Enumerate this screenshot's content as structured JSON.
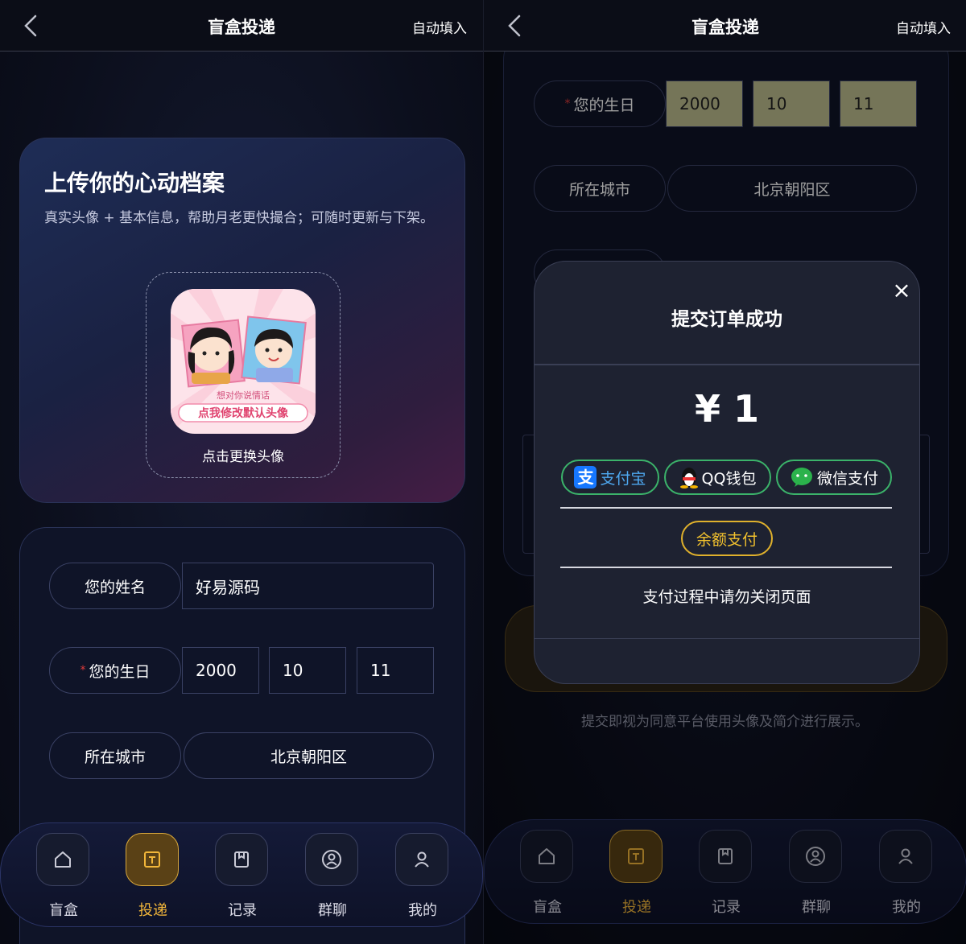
{
  "header": {
    "title": "盲盒投递",
    "autofill": "自动填入"
  },
  "upload_card": {
    "title": "上传你的心动档案",
    "subtitle": "真实头像 + 基本信息，帮助月老更快撮合；可随时更新与下架。",
    "avatar_line1": "想对你说情话",
    "avatar_line2": "点我修改默认头像",
    "change_avatar": "点击更换头像"
  },
  "form": {
    "name_label": "您的姓名",
    "name_value": "好易源码",
    "birthday_label": "您的生日",
    "birthday_required": "*",
    "birth_year": "2000",
    "birth_month": "10",
    "birth_day": "11",
    "city_label": "所在城市",
    "city_value": "北京朝阳区"
  },
  "nav": [
    {
      "label": "盲盒",
      "icon": "home-icon",
      "active": false
    },
    {
      "label": "投递",
      "icon": "deliver-icon",
      "active": true
    },
    {
      "label": "记录",
      "icon": "record-icon",
      "active": false
    },
    {
      "label": "群聊",
      "icon": "group-chat-icon",
      "active": false
    },
    {
      "label": "我的",
      "icon": "profile-icon",
      "active": false
    }
  ],
  "modal": {
    "close": "×",
    "title": "提交订单成功",
    "amount": "¥ 1",
    "alipay": "支付宝",
    "qq_wallet": "QQ钱包",
    "wechat_pay": "微信支付",
    "balance_pay": "余额支付",
    "note": "支付过程中请勿关闭页面"
  },
  "agreement": "提交即视为同意平台使用头像及简介进行展示。",
  "colors": {
    "accent": "#f2b63a",
    "birthday_fill": "#bdbd8e",
    "pay_green": "#3bb36a",
    "balance_gold": "#e0b12c"
  }
}
